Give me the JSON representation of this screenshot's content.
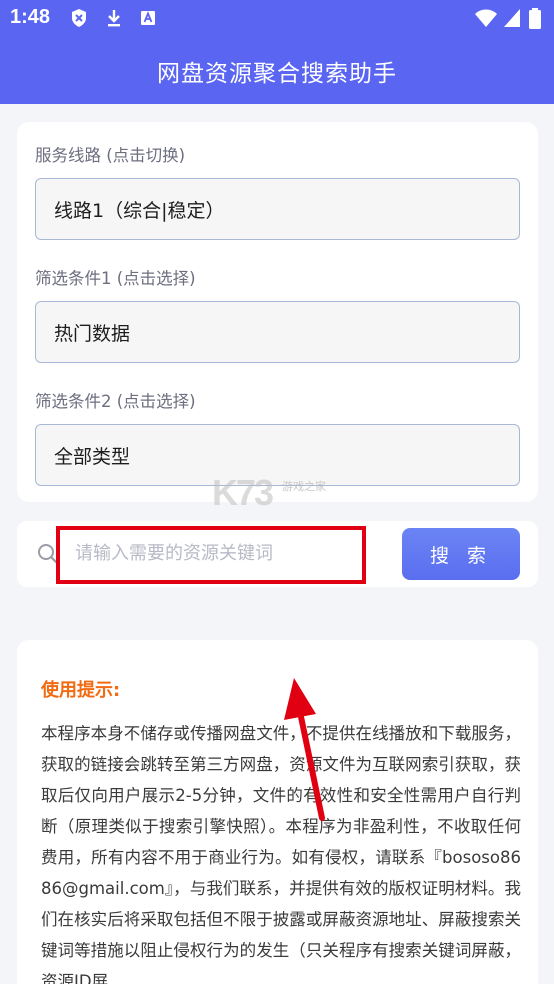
{
  "status_bar": {
    "time": "1:48",
    "icons": [
      "shield-icon",
      "download-icon",
      "a-badge-icon",
      "wifi-icon",
      "cellular-icon",
      "battery-icon"
    ]
  },
  "app_bar": {
    "title": "网盘资源聚合搜索助手"
  },
  "filters": {
    "line_label": "服务线路 (点击切换)",
    "line_value": "线路1（综合|稳定）",
    "cond1_label": "筛选条件1 (点击选择)",
    "cond1_value": "热门数据",
    "cond2_label": "筛选条件2 (点击选择)",
    "cond2_value": "全部类型"
  },
  "search": {
    "placeholder": "请输入需要的资源关键词",
    "button_label": "搜 索"
  },
  "tips": {
    "title": "使用提示:",
    "body": "本程序本身不储存或传播网盘文件，不提供在线播放和下载服务，获取的链接会跳转至第三方网盘，资源文件为互联网索引获取，获取后仅向用户展示2-5分钟，文件的有效性和安全性需用户自行判断（原理类似于搜索引擎快照）。本程序为非盈利性，不收取任何费用，所有内容不用于商业行为。如有侵权，请联系『bososo8686@gmail.com』，与我们联系，并提供有效的版权证明材料。我们在核实后将采取包括但不限于披露或屏蔽资源地址、屏蔽搜索关键词等措施以阻止侵权行为的发生（只关程序有搜索关键词屏蔽，资源ID屏"
  },
  "watermark": {
    "brand": "K73",
    "sub": "游戏之家"
  },
  "colors": {
    "primary": "#5a66f2",
    "accent": "#f26a12",
    "highlight": "#e00012"
  }
}
